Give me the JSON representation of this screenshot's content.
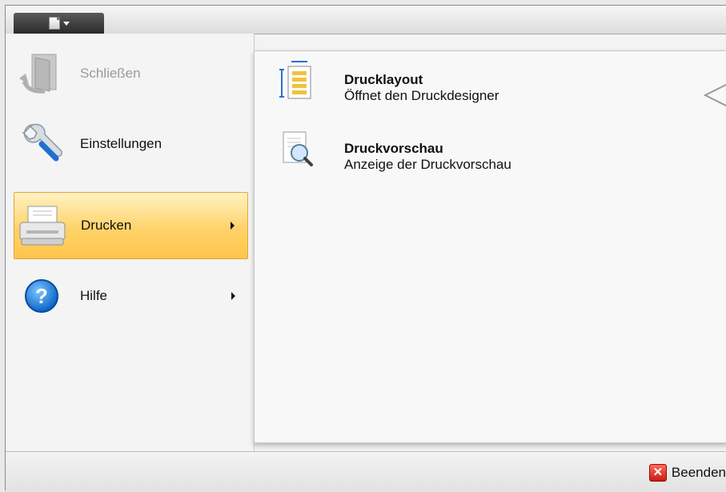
{
  "menu": {
    "items": [
      {
        "label": "Schließen",
        "icon": "door-exit-icon",
        "enabled": false,
        "submenu": false
      },
      {
        "label": "Einstellungen",
        "icon": "wrench-icon",
        "enabled": true,
        "submenu": false
      },
      {
        "label": "Drucken",
        "icon": "printer-icon",
        "enabled": true,
        "submenu": true,
        "active": true
      },
      {
        "label": "Hilfe",
        "icon": "help-icon",
        "enabled": true,
        "submenu": true
      }
    ]
  },
  "submenu": {
    "items": [
      {
        "title": "Drucklayout",
        "description": "Öffnet den Druckdesigner",
        "icon": "print-layout-icon"
      },
      {
        "title": "Druckvorschau",
        "description": "Anzeige der Druckvorschau",
        "icon": "print-preview-icon"
      }
    ]
  },
  "footer": {
    "exit_label": "Beenden",
    "exit_icon": "close-icon"
  },
  "colors": {
    "active_highlight": "#ffd36a",
    "active_border": "#e4a335",
    "exit_red": "#cc1b12"
  }
}
